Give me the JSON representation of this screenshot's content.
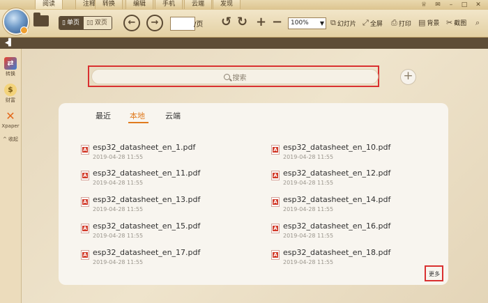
{
  "tabs": [
    "阅读",
    "注释",
    "转换",
    "编辑",
    "手机",
    "云端",
    "发现"
  ],
  "active_tab": "阅读",
  "toolbar": {
    "single_page": "单页",
    "double_page": "双页",
    "page_input": "",
    "page_suffix": "/页",
    "zoom": "100%",
    "slideshow": "幻灯片",
    "fullscreen": "全屏",
    "print": "打印",
    "background": "背景",
    "screenshot": "截图"
  },
  "sidebar": {
    "items": [
      {
        "label": "转换",
        "icon": "convert-icon"
      },
      {
        "label": "财富",
        "icon": "wealth-icon"
      },
      {
        "label": "Xpaper",
        "icon": "xpaper-icon"
      }
    ],
    "collapse": "^ 收起"
  },
  "search": {
    "placeholder": "搜索"
  },
  "panel": {
    "tabs": [
      "最近",
      "本地",
      "云端"
    ],
    "active": "本地",
    "more": "更多"
  },
  "files": [
    {
      "name": "esp32_datasheet_en_1.pdf",
      "date": "2019-04-28 11:55"
    },
    {
      "name": "esp32_datasheet_en_10.pdf",
      "date": "2019-04-28 11:55"
    },
    {
      "name": "esp32_datasheet_en_11.pdf",
      "date": "2019-04-28 11:55"
    },
    {
      "name": "esp32_datasheet_en_12.pdf",
      "date": "2019-04-28 11:55"
    },
    {
      "name": "esp32_datasheet_en_13.pdf",
      "date": "2019-04-28 11:55"
    },
    {
      "name": "esp32_datasheet_en_14.pdf",
      "date": "2019-04-28 11:55"
    },
    {
      "name": "esp32_datasheet_en_15.pdf",
      "date": "2019-04-28 11:55"
    },
    {
      "name": "esp32_datasheet_en_16.pdf",
      "date": "2019-04-28 11:55"
    },
    {
      "name": "esp32_datasheet_en_17.pdf",
      "date": "2019-04-28 11:55"
    },
    {
      "name": "esp32_datasheet_en_18.pdf",
      "date": "2019-04-28 11:55"
    }
  ],
  "colors": {
    "accent": "#e07a1e",
    "highlight": "#d93030",
    "toolbar": "#5e4d36"
  }
}
